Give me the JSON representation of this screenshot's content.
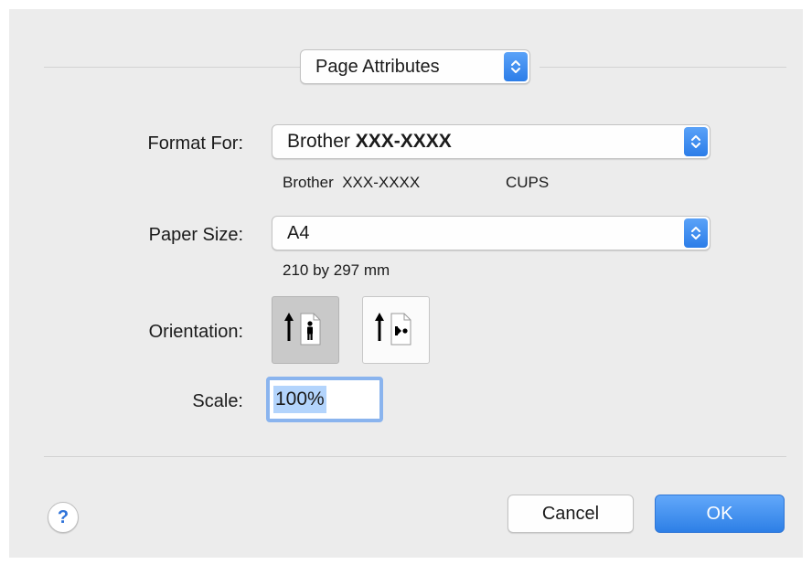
{
  "dialog": {
    "section": {
      "value": "Page Attributes",
      "icon": "chevron-updown-icon"
    },
    "format_for": {
      "label": "Format For:",
      "value_prefix": "Brother",
      "value_model": "XXX-XXXX",
      "printer_name": "Brother  XXX-XXXX",
      "printer_driver": "CUPS"
    },
    "paper_size": {
      "label": "Paper Size:",
      "value": "A4",
      "dimensions": "210 by 297 mm"
    },
    "orientation": {
      "label": "Orientation:",
      "options": [
        {
          "name": "portrait",
          "icon": "portrait-orientation-icon",
          "selected": true
        },
        {
          "name": "landscape",
          "icon": "landscape-orientation-icon",
          "selected": false
        }
      ]
    },
    "scale": {
      "label": "Scale:",
      "value": "100%"
    },
    "buttons": {
      "help": "?",
      "cancel": "Cancel",
      "ok": "OK"
    },
    "colors": {
      "accent": "#2d7fe6",
      "background": "#ececec",
      "selection": "#b3d4fc"
    }
  }
}
